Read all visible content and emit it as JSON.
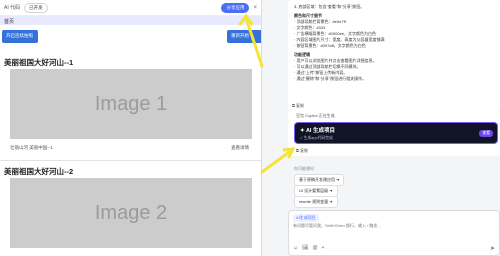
{
  "preview": {
    "app_title": "AI 代码",
    "pill": "已开发",
    "share_button": "分享应用",
    "close": "×",
    "home_label": "首页",
    "btn_left": "开启连续拍照",
    "btn_right": "重新开始",
    "sections": [
      {
        "title": "美丽祖国大好河山--1",
        "image": "Image 1",
        "caption": "壮丽山河 美丽中国--1",
        "detail": "查看详情"
      },
      {
        "title": "美丽祖国大好河山--2",
        "image": "Image 2"
      }
    ]
  },
  "chat": {
    "message_lines": [
      "3. 底部区域：包含\"查看\"和\"分享\"按钮。",
      "",
      "颜色和尺寸细节",
      "· 顶部导航栏背景色：#e0e7ff",
      "· 文字颜色：#333",
      "· 广告横幅背景色：#0000ee，文字颜色为白色",
      "· 内容区域图片尺寸：宽度、高度为父容器宽度铺满",
      "· 按钮背景色：#007aff，文字颜色为白色",
      "",
      "功能逻辑",
      "· 用户可以浏览图片并点击查看图片详细信息。",
      "· 可以通过顶部导航栏切换不同模块。",
      "· 通过\"上传\"按钮上传新内容。",
      "· 通过\"删除\"和\"分享\"按钮进行相关操作。"
    ],
    "copy": "复制",
    "assistant": "豆包 Copilot 正在生成",
    "ai_card_title": "AI 生成项目",
    "ai_card_sub": "生成app代码完成",
    "ai_card_badge": "查看",
    "suggestions_label": "你可能想问",
    "suggestions": [
      "基于原稿开发建应用",
      "UI 设计要素层级",
      "rewrite 规则变量"
    ],
    "input_tag": "AI生成项目",
    "input_placeholder": "有问题尽管问我，Shift+Enter 换行，输入 / 触发…",
    "input_icons": [
      "☺",
      "🖼",
      "@",
      "+"
    ],
    "send": "➤"
  }
}
